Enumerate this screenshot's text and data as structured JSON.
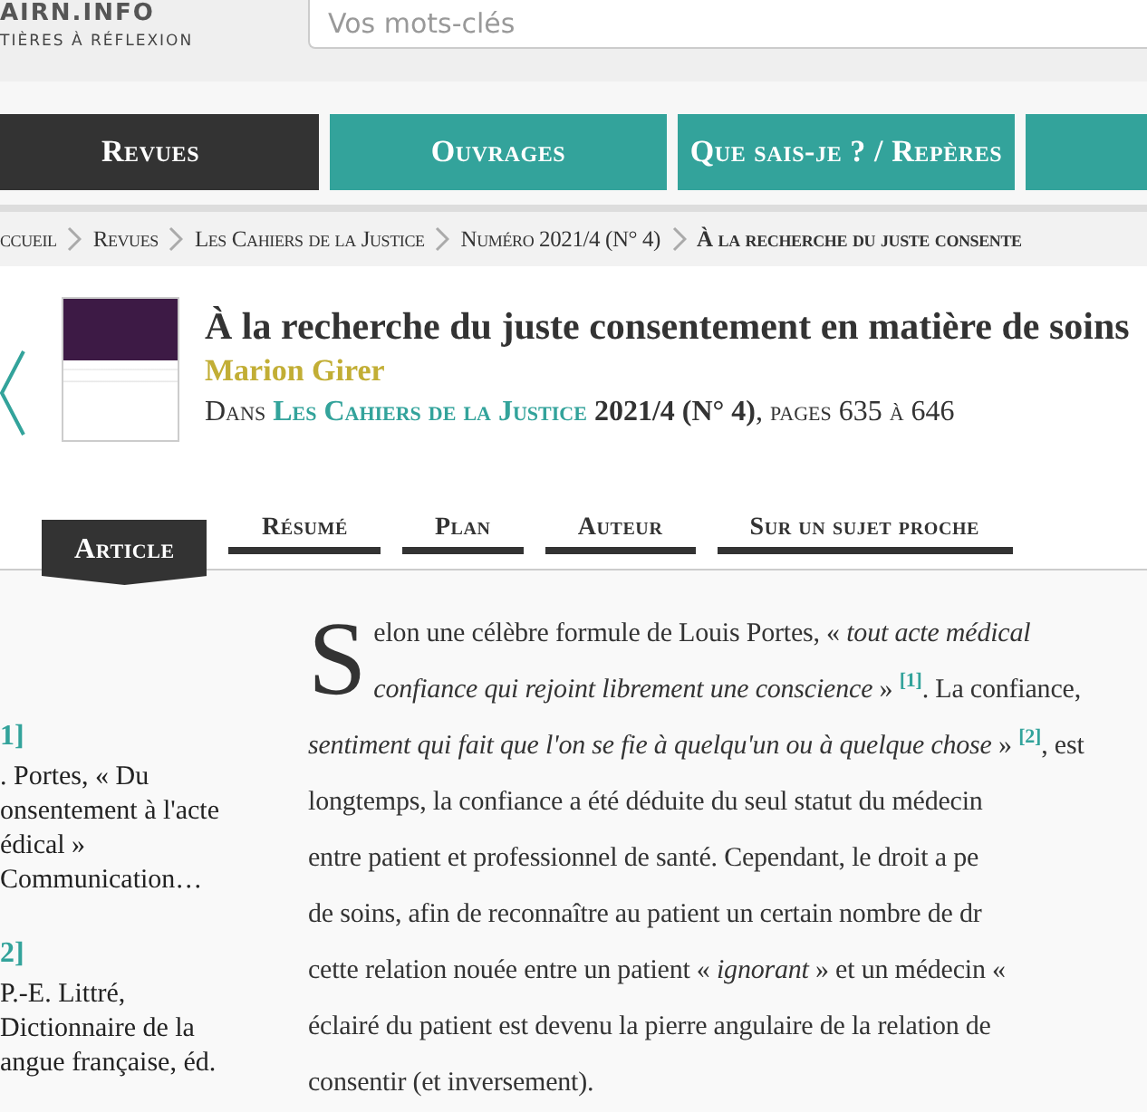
{
  "header": {
    "logo": "AIRN.INFO",
    "tagline": "TIÈRES À RÉFLEXION",
    "search": {
      "placeholder": "Vos mots-clés"
    }
  },
  "nav": [
    {
      "label": "Revues",
      "selected": true
    },
    {
      "label": "Ouvrages",
      "selected": false
    },
    {
      "label": "Que sais-je ? / Repères",
      "selected": false
    },
    {
      "selected": false
    }
  ],
  "breadcrumb": [
    {
      "label": "ccueil",
      "current": false
    },
    {
      "label": "Revues",
      "current": false
    },
    {
      "label": "Les Cahiers de la Justice",
      "current": false
    },
    {
      "label": "Numéro 2021/4 (N° 4)",
      "current": false
    },
    {
      "label": "À la recherche du juste consente",
      "current": true
    }
  ],
  "article": {
    "title": "À la recherche du juste consentement en matière de soins",
    "author": "Marion Girer",
    "source_prefix": "Dans",
    "journal": "Les Cahiers de la Justice",
    "source_suffix": " **2021/4 (N° 4)**, pages 635 à 646"
  },
  "tabs": [
    {
      "label": "Article",
      "selected": true
    },
    {
      "label": "Résumé",
      "selected": false
    },
    {
      "label": "Plan",
      "selected": false
    },
    {
      "label": "Auteur",
      "selected": false
    },
    {
      "label": "Sur un sujet proche",
      "selected": false
    }
  ],
  "notes": [
    {
      "ref": "1]",
      "lines": [
        ". Portes, « Du",
        "onsentement à l'acte",
        "édical »",
        "Communication…"
      ]
    },
    {
      "ref": "2]",
      "lines": [
        "P.-E. Littré,",
        "Dictionnaire de la",
        "angue française, éd."
      ]
    }
  ],
  "body": {
    "dropcap": "S",
    "lines": [
      [
        {
          "kind": "text",
          "text": "elon une célèbre formule de Louis Portes, « *tout acte médical*"
        }
      ],
      [
        {
          "kind": "text",
          "text": "*confiance qui rejoint librement une conscience* » "
        },
        {
          "kind": "note",
          "text": "[1]"
        },
        {
          "kind": "text",
          "text": ". La confiance,"
        }
      ],
      [
        {
          "kind": "text",
          "text": "*sentiment qui fait que l'on se fie à quelqu'un ou à quelque chose* » "
        },
        {
          "kind": "note",
          "text": "[2]"
        },
        {
          "kind": "text",
          "text": ", est"
        }
      ],
      [
        {
          "kind": "text",
          "text": "longtemps, la confiance a été déduite du seul statut du médecin"
        }
      ],
      [
        {
          "kind": "text",
          "text": "entre patient et professionnel de santé. Cependant, le droit a pe"
        }
      ],
      [
        {
          "kind": "text",
          "text": "de soins, afin de reconnaître au patient un certain nombre de dr"
        }
      ],
      [
        {
          "kind": "text",
          "text": "cette relation nouée entre un patient « *ignorant* » et un médecin «"
        }
      ],
      [
        {
          "kind": "text",
          "text": "éclairé du patient est devenu la pierre angulaire de la relation de"
        }
      ],
      [
        {
          "kind": "text",
          "text": "consentir (et inversement)."
        }
      ]
    ]
  }
}
